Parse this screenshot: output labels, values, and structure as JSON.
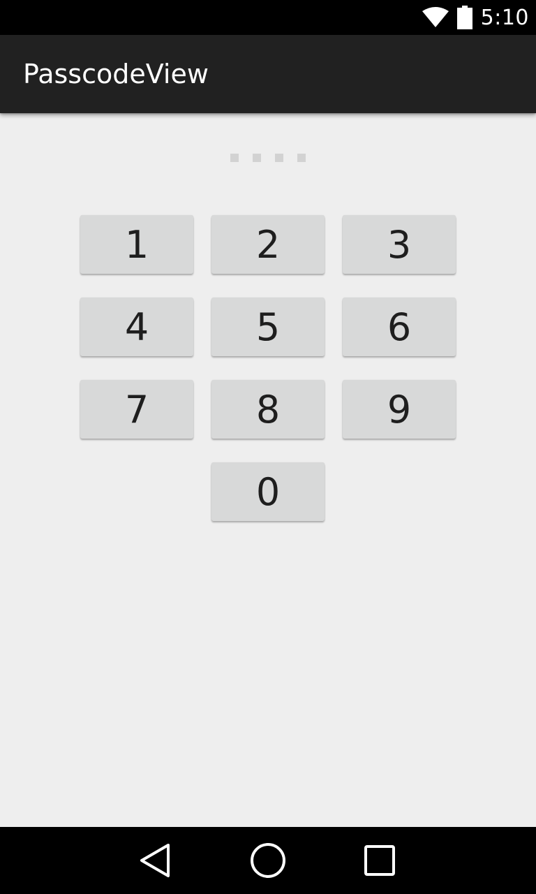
{
  "status_bar": {
    "time": "5:10",
    "icons": [
      "wifi-icon",
      "battery-icon"
    ]
  },
  "app_bar": {
    "title": "PasscodeView"
  },
  "passcode": {
    "length": 4,
    "entered": 0
  },
  "keypad": {
    "keys": [
      "1",
      "2",
      "3",
      "4",
      "5",
      "6",
      "7",
      "8",
      "9",
      "0"
    ]
  },
  "nav_bar": {
    "buttons": [
      "back-icon",
      "home-icon",
      "recents-icon"
    ]
  },
  "colors": {
    "status_bar": "#000000",
    "app_bar": "#212121",
    "background": "#eeeeee",
    "key": "#d8d9d9",
    "dot": "#d2d2d2"
  }
}
